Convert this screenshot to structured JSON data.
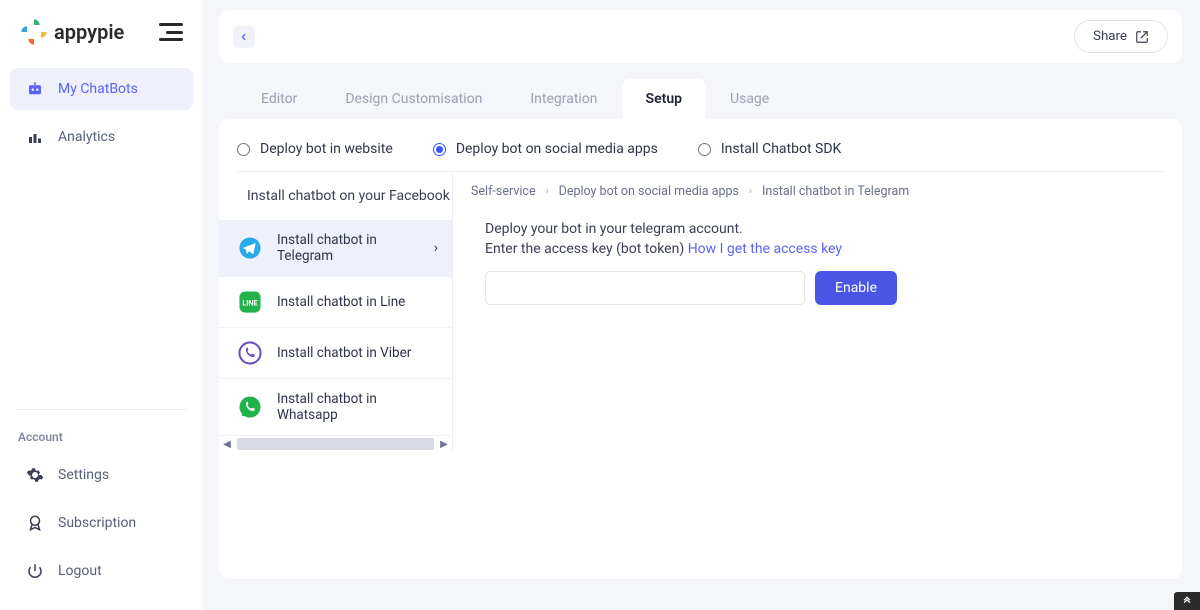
{
  "brand": {
    "name": "appypie"
  },
  "sidebar": {
    "primary": [
      {
        "label": "My ChatBots",
        "icon": "robot-icon",
        "active": true
      },
      {
        "label": "Analytics",
        "icon": "analytics-icon",
        "active": false
      }
    ],
    "accountTitle": "Account",
    "account": [
      {
        "label": "Settings",
        "icon": "gear-icon"
      },
      {
        "label": "Subscription",
        "icon": "badge-icon"
      },
      {
        "label": "Logout",
        "icon": "power-icon"
      }
    ]
  },
  "topbar": {
    "share": "Share"
  },
  "tabs": [
    {
      "label": "Editor",
      "active": false
    },
    {
      "label": "Design Customisation",
      "active": false
    },
    {
      "label": "Integration",
      "active": false
    },
    {
      "label": "Setup",
      "active": true
    },
    {
      "label": "Usage",
      "active": false
    }
  ],
  "deployOptions": [
    {
      "label": "Deploy bot in website",
      "selected": false
    },
    {
      "label": "Deploy bot on social media apps",
      "selected": true
    },
    {
      "label": "Install Chatbot SDK",
      "selected": false
    }
  ],
  "installList": {
    "heading": "Install chatbot on your Facebook page",
    "items": [
      {
        "label": "Install chatbot in Telegram",
        "platform": "telegram",
        "active": true
      },
      {
        "label": "Install chatbot in Line",
        "platform": "line",
        "active": false
      },
      {
        "label": "Install chatbot in Viber",
        "platform": "viber",
        "active": false
      },
      {
        "label": "Install chatbot in Whatsapp",
        "platform": "whatsapp",
        "active": false
      }
    ]
  },
  "breadcrumb": [
    "Self-service",
    "Deploy bot on social media apps",
    "Install chatbot in Telegram"
  ],
  "detail": {
    "line1": "Deploy your bot in your telegram account.",
    "line2_prefix": "Enter the access key (bot token) ",
    "line2_link": "How I get the access key",
    "enable": "Enable",
    "inputPlaceholder": ""
  },
  "colors": {
    "accent": "#4a55e6",
    "telegram": "#29a9ea",
    "line": "#22b24c",
    "viber": "#6b4fbb",
    "whatsapp": "#22b24c"
  }
}
